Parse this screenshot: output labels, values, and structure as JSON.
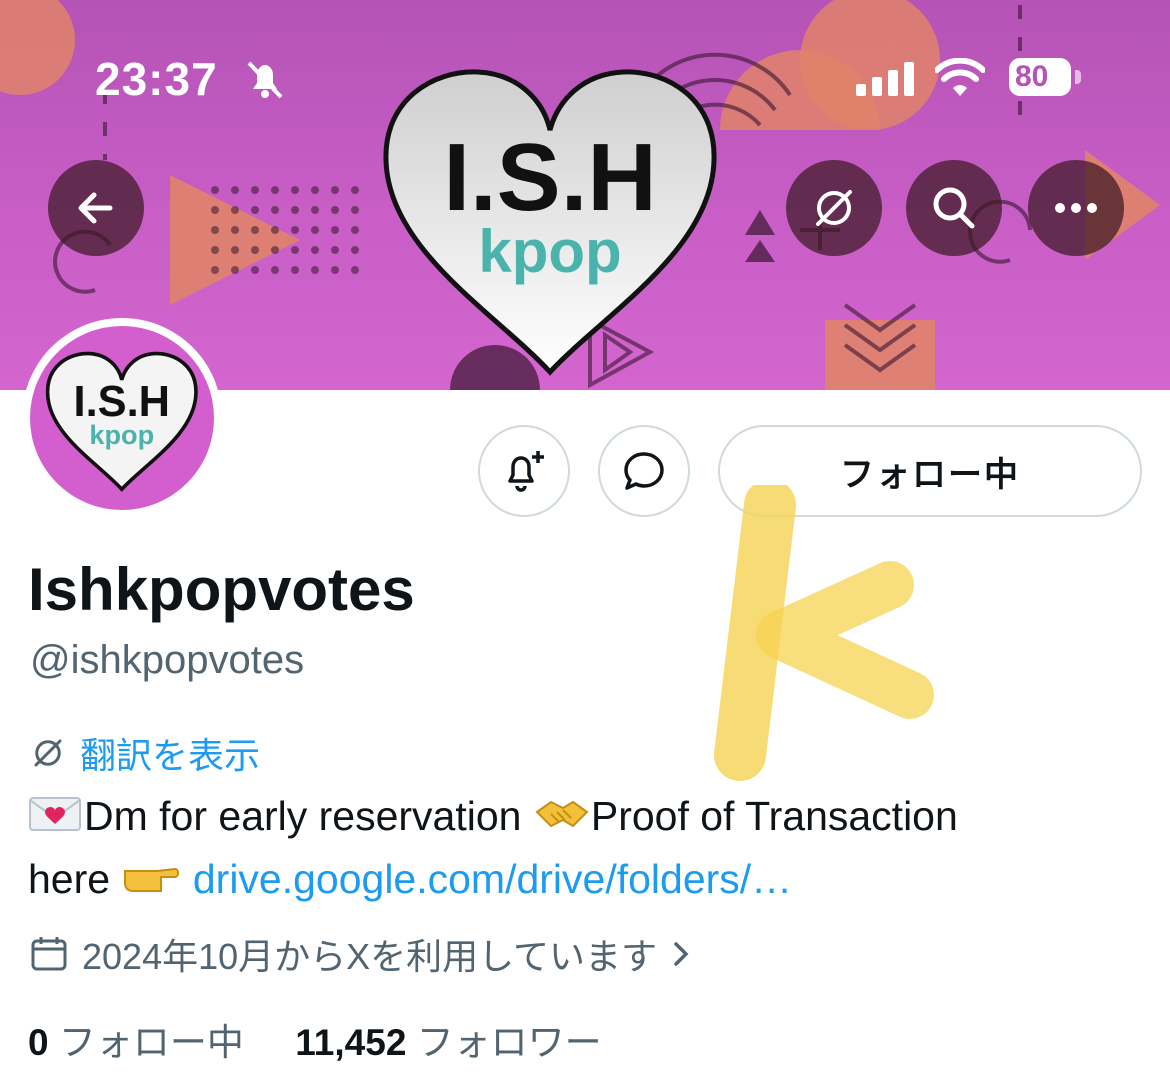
{
  "status_bar": {
    "time": "23:37",
    "battery": "80"
  },
  "banner": {
    "logo_text": "I.S.H",
    "logo_subtext": "kpop"
  },
  "header_icons": {
    "back": "arrow-left-icon",
    "grok": "grok-icon",
    "search": "search-icon",
    "more": "more-icon"
  },
  "avatar": {
    "logo_text": "I.S.H",
    "logo_subtext": "kpop"
  },
  "actions": {
    "notify_icon": "bell-plus-icon",
    "message_icon": "chat-bubble-icon",
    "follow_label": "フォロー中"
  },
  "profile": {
    "name": "Ishkpopvotes",
    "handle": "@ishkpopvotes",
    "translate_label": "翻訳を表示",
    "bio_part1": "Dm for early reservation ",
    "bio_part2": "Proof of Transaction",
    "bio_part3": "here ",
    "bio_link": "drive.google.com/drive/folders/…",
    "joined": "2024年10月からXを利用しています"
  },
  "stats": {
    "following_count": "0",
    "following_label": "フォロー中",
    "followers_count": "11,452",
    "followers_label": "フォロワー"
  },
  "colors": {
    "banner": "#c85ec6",
    "accent_link": "#1d9bf0",
    "muted_text": "#536471",
    "handwriting": "#f5d352"
  }
}
